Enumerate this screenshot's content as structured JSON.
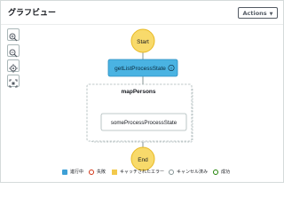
{
  "panel": {
    "title": "グラフビュー",
    "actions_label": "Actions"
  },
  "tools": [
    {
      "name": "zoom-in-icon"
    },
    {
      "name": "zoom-out-icon"
    },
    {
      "name": "center-icon"
    },
    {
      "name": "fit-icon"
    }
  ],
  "graph": {
    "start_label": "Start",
    "end_label": "End",
    "task_label": "getListProcessState",
    "map_label": "mapPersons",
    "inner_task_label": "someProcessProcessState"
  },
  "legend": [
    {
      "label": "進行中",
      "color": "#3ea0d6"
    },
    {
      "label": "失敗",
      "color": "#d13212"
    },
    {
      "label": "キャッチされたエラー",
      "color": "#f2c94c"
    },
    {
      "label": "キャンセル済み",
      "color": "#aab7b8"
    },
    {
      "label": "成功",
      "color": "#1d8102"
    }
  ]
}
